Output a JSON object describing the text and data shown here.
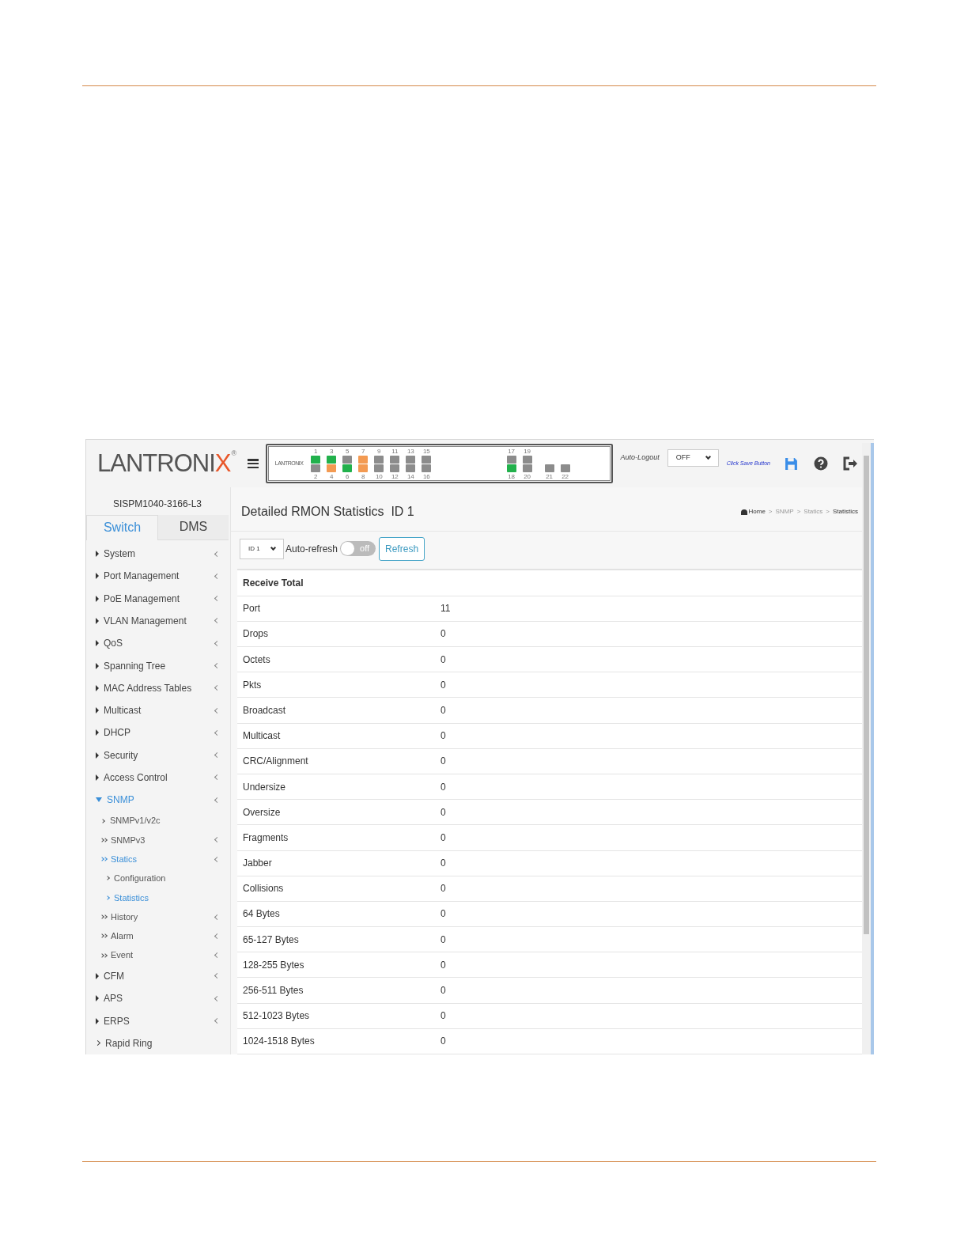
{
  "header": {
    "logo": "LANTRONIX",
    "logo_mark": "®",
    "device_logo": "LANTRONIX",
    "ports_top": [
      {
        "label": "1",
        "color": "#22b14c"
      },
      {
        "label": "3",
        "color": "#22b14c"
      },
      {
        "label": "5",
        "color": "#8c8c8c"
      },
      {
        "label": "7",
        "color": "#f39a52"
      },
      {
        "label": "9",
        "color": "#8c8c8c"
      },
      {
        "label": "11",
        "color": "#8c8c8c"
      },
      {
        "label": "13",
        "color": "#8c8c8c"
      },
      {
        "label": "15",
        "color": "#8c8c8c"
      }
    ],
    "ports_bottom": [
      {
        "label": "2",
        "color": "#8c8c8c"
      },
      {
        "label": "4",
        "color": "#f39a52"
      },
      {
        "label": "6",
        "color": "#22b14c"
      },
      {
        "label": "8",
        "color": "#f39a52"
      },
      {
        "label": "10",
        "color": "#8c8c8c"
      },
      {
        "label": "12",
        "color": "#8c8c8c"
      },
      {
        "label": "14",
        "color": "#8c8c8c"
      },
      {
        "label": "16",
        "color": "#8c8c8c"
      }
    ],
    "ports2_top": [
      {
        "label": "17",
        "color": "#8c8c8c"
      },
      {
        "label": "19",
        "color": "#8c8c8c"
      }
    ],
    "ports2_bottom": [
      {
        "label": "18",
        "color": "#22b14c"
      },
      {
        "label": "20",
        "color": "#8c8c8c"
      }
    ],
    "sfp_ports": [
      {
        "label": "21",
        "color": "#8c8c8c"
      },
      {
        "label": "22",
        "color": "#8c8c8c"
      }
    ],
    "auto_logout_label": "Auto-Logout",
    "auto_logout_value": "OFF",
    "save_hint": "Click Save Button"
  },
  "sidebar": {
    "device": "SISPM1040-3166-L3",
    "tabs": [
      {
        "label": "Switch",
        "selected": true
      },
      {
        "label": "DMS",
        "selected": false
      }
    ],
    "items": [
      {
        "label": "System",
        "expanded": false,
        "selected": false
      },
      {
        "label": "Port Management",
        "expanded": false,
        "selected": false
      },
      {
        "label": "PoE Management",
        "expanded": false,
        "selected": false
      },
      {
        "label": "VLAN Management",
        "expanded": false,
        "selected": false
      },
      {
        "label": "QoS",
        "expanded": false,
        "selected": false
      },
      {
        "label": "Spanning Tree",
        "expanded": false,
        "selected": false
      },
      {
        "label": "MAC Address Tables",
        "expanded": false,
        "selected": false
      },
      {
        "label": "Multicast",
        "expanded": false,
        "selected": false
      },
      {
        "label": "DHCP",
        "expanded": false,
        "selected": false
      },
      {
        "label": "Security",
        "expanded": false,
        "selected": false
      },
      {
        "label": "Access Control",
        "expanded": false,
        "selected": false
      },
      {
        "label": "SNMP",
        "expanded": true,
        "selected": true,
        "children": [
          {
            "label": "SNMPv1/v2c",
            "kind": "leaf",
            "selected": false
          },
          {
            "label": "SNMPv3",
            "kind": "group",
            "selected": false
          },
          {
            "label": "Statics",
            "kind": "group",
            "selected": true,
            "children": [
              {
                "label": "Configuration",
                "selected": false
              },
              {
                "label": "Statistics",
                "selected": true
              }
            ]
          },
          {
            "label": "History",
            "kind": "group",
            "selected": false
          },
          {
            "label": "Alarm",
            "kind": "group",
            "selected": false
          },
          {
            "label": "Event",
            "kind": "group",
            "selected": false
          }
        ]
      },
      {
        "label": "CFM",
        "expanded": false,
        "selected": false
      },
      {
        "label": "APS",
        "expanded": false,
        "selected": false
      },
      {
        "label": "ERPS",
        "expanded": false,
        "selected": false
      },
      {
        "label": "Rapid Ring",
        "expanded": false,
        "selected": false,
        "kind": "leaf"
      }
    ]
  },
  "content": {
    "title": "Detailed RMON Statistics  ID 1",
    "breadcrumb_separator": ">",
    "breadcrumb": [
      {
        "label": "Home"
      },
      {
        "label": "SNMP"
      },
      {
        "label": "Statics"
      },
      {
        "label": "Statistics"
      }
    ],
    "id_select": "ID 1",
    "auto_refresh_label": "Auto-refresh",
    "auto_refresh": {
      "on": false,
      "label": "off"
    },
    "refresh_button": "Refresh",
    "table": {
      "section": "Receive Total",
      "rows": [
        [
          "Port",
          "11"
        ],
        [
          "Drops",
          "0"
        ],
        [
          "Octets",
          "0"
        ],
        [
          "Pkts",
          "0"
        ],
        [
          "Broadcast",
          "0"
        ],
        [
          "Multicast",
          "0"
        ],
        [
          "CRC/Alignment",
          "0"
        ],
        [
          "Undersize",
          "0"
        ],
        [
          "Oversize",
          "0"
        ],
        [
          "Fragments",
          "0"
        ],
        [
          "Jabber",
          "0"
        ],
        [
          "Collisions",
          "0"
        ],
        [
          "64 Bytes",
          "0"
        ],
        [
          "65-127 Bytes",
          "0"
        ],
        [
          "128-255 Bytes",
          "0"
        ],
        [
          "256-511 Bytes",
          "0"
        ],
        [
          "512-1023 Bytes",
          "0"
        ],
        [
          "1024-1518 Bytes",
          "0"
        ]
      ]
    }
  }
}
